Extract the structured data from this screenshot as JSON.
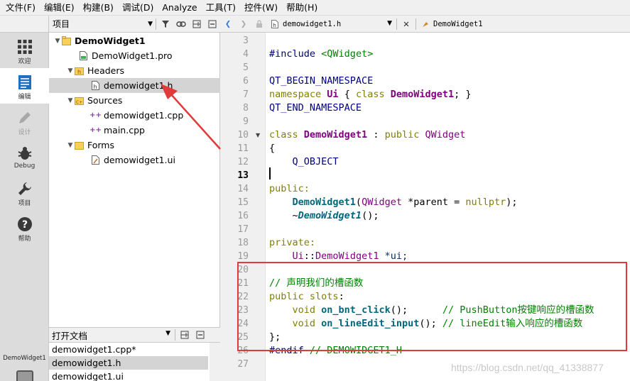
{
  "menubar": [
    "文件(F)",
    "编辑(E)",
    "构建(B)",
    "调试(D)",
    "Analyze",
    "工具(T)",
    "控件(W)",
    "帮助(H)"
  ],
  "modes": [
    {
      "label": "欢迎",
      "icon": "grid-icon"
    },
    {
      "label": "编辑",
      "icon": "document-icon"
    },
    {
      "label": "设计",
      "icon": "pencil-icon"
    },
    {
      "label": "Debug",
      "icon": "bug-icon"
    },
    {
      "label": "项目",
      "icon": "wrench-icon"
    },
    {
      "label": "帮助",
      "icon": "help-icon"
    }
  ],
  "kit_label": "DemoWidget1",
  "project_panel": {
    "selector": "项目"
  },
  "tree": {
    "project": "DemoWidget1",
    "pro_file": "DemoWidget1.pro",
    "headers": "Headers",
    "header_file": "demowidget1.h",
    "sources": "Sources",
    "source_files": [
      "demowidget1.cpp",
      "main.cpp"
    ],
    "forms": "Forms",
    "form_file": "demowidget1.ui"
  },
  "open_docs": {
    "title": "打开文档",
    "items": [
      "demowidget1.cpp*",
      "demowidget1.h",
      "demowidget1.ui"
    ]
  },
  "editor": {
    "file": "demowidget1.h",
    "symbol": "DemoWidget1",
    "line_numbers": [
      "3",
      "4",
      "5",
      "6",
      "7",
      "8",
      "9",
      "10",
      "11",
      "12",
      "13",
      "14",
      "15",
      "16",
      "17",
      "18",
      "19",
      "20",
      "21",
      "22",
      "23",
      "24",
      "25",
      "26",
      "27"
    ],
    "current_line": "13"
  },
  "code": {
    "l4_pp": "#include",
    "l4_inc": "<QWidget>",
    "l6": "QT_BEGIN_NAMESPACE",
    "l7_ns": "namespace",
    "l7_ui": "Ui",
    "l7_b1": " { ",
    "l7_class": "class",
    "l7_name": "DemoWidget1",
    "l7_b2": "; }",
    "l8": "QT_END_NAMESPACE",
    "l10_class": "class",
    "l10_name": "DemoWidget1",
    "l10_colon": " : ",
    "l10_public": "public",
    "l10_base": "QWidget",
    "l11": "{",
    "l12": "Q_OBJECT",
    "l14": "public:",
    "l15_fn": "DemoWidget1",
    "l15_p1": "(",
    "l15_type": "QWidget",
    "l15_p2": " *parent = ",
    "l15_null": "nullptr",
    "l15_p3": ");",
    "l16_tilde": "~",
    "l16_fn": "DemoWidget1",
    "l16_p": "();",
    "l18": "private:",
    "l19_ns": "Ui",
    "l19_sep": "::",
    "l19_type": "DemoWidget1",
    "l19_var": " *ui;",
    "l21": "// 声明我们的槽函数",
    "l22_public": "public",
    "l22_slots": "slots",
    "l22_colon": ":",
    "l23_void": "void",
    "l23_fn": "on_bnt_click",
    "l23_p": "();",
    "l23_cm": "// PushButton按键响应的槽函数",
    "l24_void": "void",
    "l24_fn": "on_lineEdit_input",
    "l24_p": "();",
    "l24_cm": "// lineEdit输入响应的槽函数",
    "l25": "};",
    "l26_pp": "#endif",
    "l26_cm": "// DEMOWIDGET1_H"
  },
  "watermark": "https://blog.csdn.net/qq_41338877",
  "colors": {
    "annotation_red": "#e03a3a",
    "keyword": "#808000",
    "class_name": "#800080",
    "comment": "#008000"
  }
}
